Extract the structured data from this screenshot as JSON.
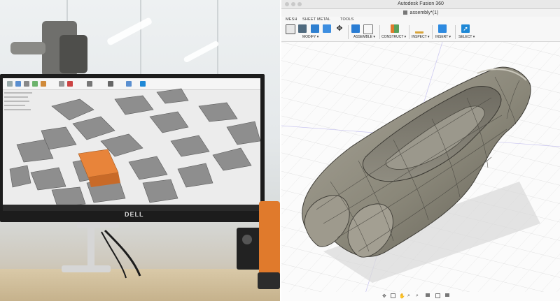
{
  "left_photo": {
    "monitor_brand": "DELL",
    "scene": "office-photo"
  },
  "fusion": {
    "window_title": "Autodesk Fusion 360",
    "document_tab": "assembly*(1)",
    "workspace_tabs": [
      "MESH",
      "SHEET METAL",
      "TOOLS"
    ],
    "ribbon_groups": [
      {
        "label": "MODIFY ▾"
      },
      {
        "label": "ASSEMBLE ▾"
      },
      {
        "label": "CONSTRUCT ▾"
      },
      {
        "label": "INSPECT ▾"
      },
      {
        "label": "INSERT ▾"
      },
      {
        "label": "SELECT ▾"
      }
    ],
    "colors": {
      "accent": "#1e88d6",
      "model": "#8d8a80",
      "model_shadow": "#5b5850",
      "grid": "#dcdcdc"
    }
  }
}
